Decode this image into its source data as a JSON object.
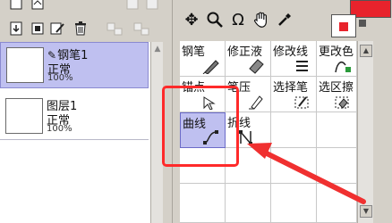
{
  "layers": {
    "items": [
      {
        "name": "钢笔1",
        "mode": "正常",
        "opacity": "100%",
        "selected": true,
        "vector": true
      },
      {
        "name": "图层1",
        "mode": "正常",
        "opacity": "100%",
        "selected": false,
        "vector": false
      }
    ]
  },
  "colors": {
    "foreground": "#e8232c",
    "background": "#ffffff",
    "selection": "#bfc0f0",
    "annotation": "#ff2a2a"
  },
  "tools": {
    "row1": [
      {
        "label": "钢笔",
        "icon": "pen-icon"
      },
      {
        "label": "修正液",
        "icon": "eraser-icon"
      },
      {
        "label": "修改线",
        "icon": "edit-line-icon"
      },
      {
        "label": "更改色",
        "icon": "recolor-icon"
      }
    ],
    "row2": [
      {
        "label": "锚点",
        "icon": "anchor-point-icon"
      },
      {
        "label": "笔压",
        "icon": "pressure-icon"
      },
      {
        "label": "选择笔",
        "icon": "select-pen-icon"
      },
      {
        "label": "选区擦",
        "icon": "select-eraser-icon"
      }
    ],
    "row3": [
      {
        "label": "曲线",
        "icon": "curve-icon",
        "active": true
      },
      {
        "label": "折线",
        "icon": "polyline-icon"
      }
    ]
  }
}
